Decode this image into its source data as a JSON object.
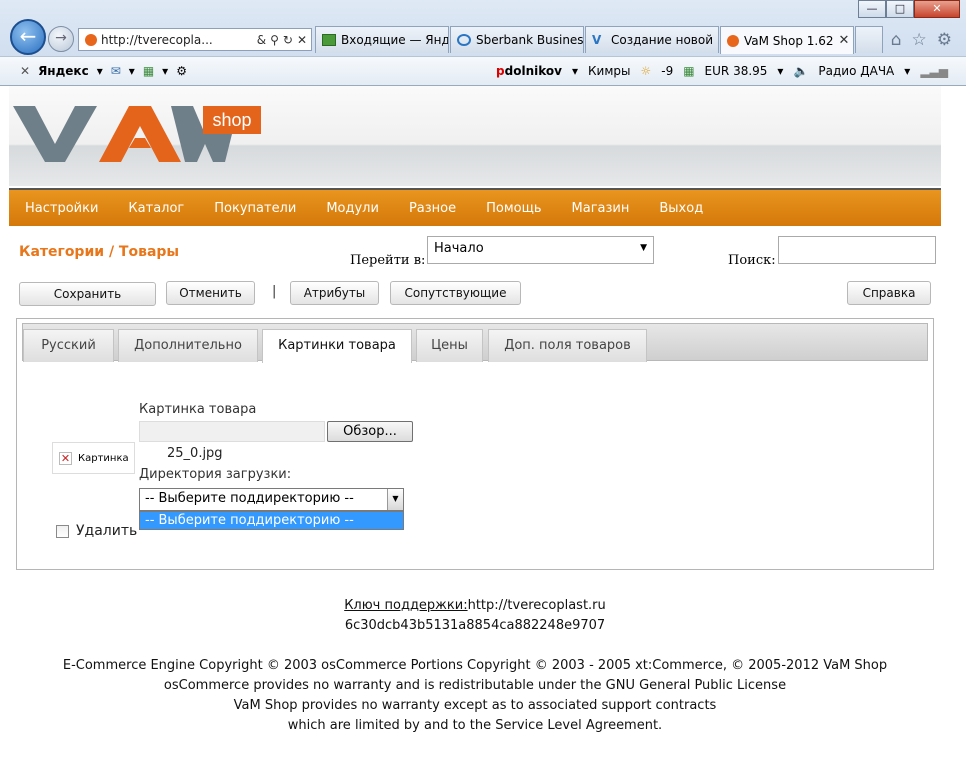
{
  "browser": {
    "address": "http://tverecopla...",
    "tabs": [
      {
        "label": "Входящие — Янд...",
        "icon": "mail-icon"
      },
      {
        "label": "Sberbank Business...",
        "icon": "ie-icon"
      },
      {
        "label": "Создание новой ...",
        "icon": "v-icon"
      },
      {
        "label": "VaM Shop 1.62",
        "icon": "orange-dot-icon",
        "active": true
      }
    ],
    "toolbar": {
      "yandex": "Яндекс",
      "user": "pdolnikov",
      "city": "Кимры",
      "weather": "-9",
      "currency": "EUR 38.95",
      "radio": "Радио ДАЧА"
    }
  },
  "logo": {
    "text": "VaM",
    "badge": "shop"
  },
  "menu": [
    "Настройки",
    "Каталог",
    "Покупатели",
    "Модули",
    "Разное",
    "Помощь",
    "Магазин",
    "Выход"
  ],
  "page_title": "Категории / Товары",
  "goto": {
    "label": "Перейти в:",
    "value": "Начало"
  },
  "search": {
    "label": "Поиск:",
    "value": ""
  },
  "buttons": {
    "save": "Сохранить",
    "cancel": "Отменить",
    "separator": "|",
    "attributes": "Атрибуты",
    "related": "Сопутствующие",
    "help": "Справка"
  },
  "tabs": [
    "Русский",
    "Дополнительно",
    "Картинки товара",
    "Цены",
    "Доп. поля товаров"
  ],
  "image_form": {
    "label": "Картинка товара",
    "browse": "Обзор...",
    "thumb_alt": "Картинка",
    "filename": "25_0.jpg",
    "dir_label": "Директория загрузки:",
    "dir_value": "-- Выберите поддиректорию --",
    "dir_option": "-- Выберите поддиректорию --",
    "delete_label": "Удалить"
  },
  "footer": {
    "key_label": "Ключ поддержки:",
    "key_url": "http://tverecoplast.ru",
    "key_hash": "6c30dcb43b5131a8854ca882248e9707",
    "lines": [
      "E-Commerce Engine Copyright © 2003 osCommerce Portions Copyright © 2003 - 2005 xt:Commerce, © 2005-2012 VaM Shop",
      "osCommerce provides no warranty and is redistributable under the GNU General Public License",
      "VaM Shop provides no warranty except as to associated support contracts",
      "which are limited by and to the Service Level Agreement."
    ]
  }
}
